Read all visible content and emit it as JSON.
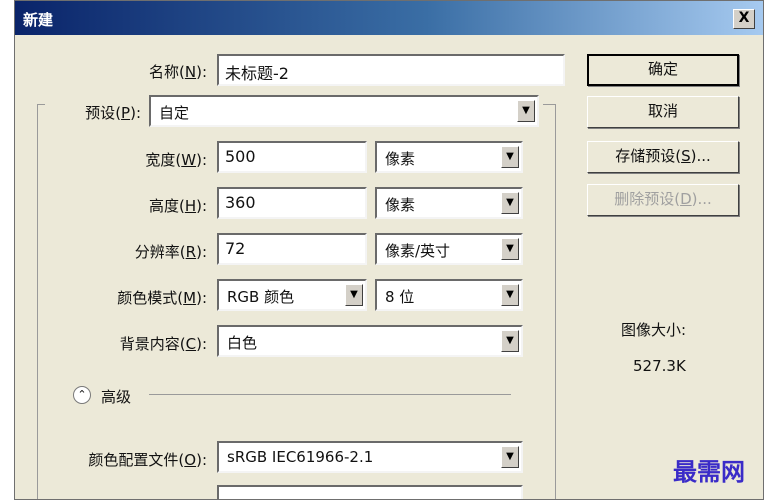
{
  "window": {
    "title": "新建",
    "close_glyph": "X"
  },
  "fields": {
    "name": {
      "label": "名称",
      "key": "N",
      "value": "未标题-2"
    },
    "preset": {
      "label": "预设",
      "key": "P",
      "value": "自定"
    },
    "width": {
      "label": "宽度",
      "key": "W",
      "value": "500",
      "unit": "像素"
    },
    "height": {
      "label": "高度",
      "key": "H",
      "value": "360",
      "unit": "像素"
    },
    "resolution": {
      "label": "分辨率",
      "key": "R",
      "value": "72",
      "unit": "像素/英寸"
    },
    "color_mode": {
      "label": "颜色模式",
      "key": "M",
      "value": "RGB 颜色",
      "depth": "8 位"
    },
    "background": {
      "label": "背景内容",
      "key": "C",
      "value": "白色"
    },
    "color_profile": {
      "label": "颜色配置文件",
      "key": "O",
      "value": "sRGB IEC61966-2.1"
    }
  },
  "advanced": {
    "label": "高级"
  },
  "buttons": {
    "ok": "确定",
    "cancel": "取消",
    "save_preset": {
      "label": "存储预设",
      "key": "S",
      "suffix": "..."
    },
    "delete_preset": {
      "label": "删除预设",
      "key": "D",
      "suffix": "..."
    }
  },
  "image_size": {
    "label": "图像大小:",
    "value": "527.3K"
  },
  "watermark": "最需网"
}
